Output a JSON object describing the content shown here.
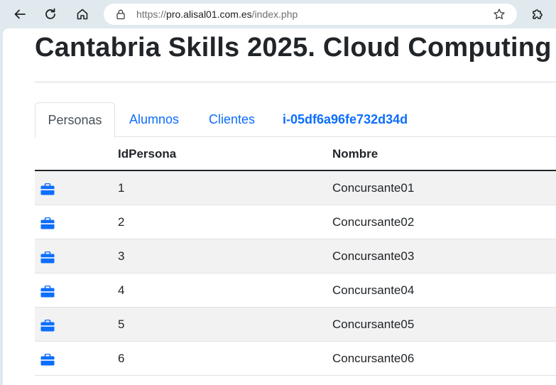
{
  "browser": {
    "url_scheme": "https://",
    "url_host": "pro.alisal01.com.es",
    "url_path": "/index.php"
  },
  "page": {
    "title": "Cantabria Skills 2025. Cloud Computing"
  },
  "tabs": [
    {
      "label": "Personas",
      "active": true
    },
    {
      "label": "Alumnos",
      "active": false
    },
    {
      "label": "Clientes",
      "active": false
    },
    {
      "label": "i-05df6a96fe732d34d",
      "active": false
    }
  ],
  "table": {
    "headers": [
      "",
      "IdPersona",
      "Nombre"
    ],
    "rows": [
      {
        "id": "1",
        "name": "Concursante01"
      },
      {
        "id": "2",
        "name": "Concursante02"
      },
      {
        "id": "3",
        "name": "Concursante03"
      },
      {
        "id": "4",
        "name": "Concursante04"
      },
      {
        "id": "5",
        "name": "Concursante05"
      },
      {
        "id": "6",
        "name": "Concursante06"
      }
    ],
    "row_icon": "briefcase-icon"
  },
  "colors": {
    "accent": "#0d6efd",
    "text": "#212529",
    "stripe": "#f2f2f2"
  }
}
